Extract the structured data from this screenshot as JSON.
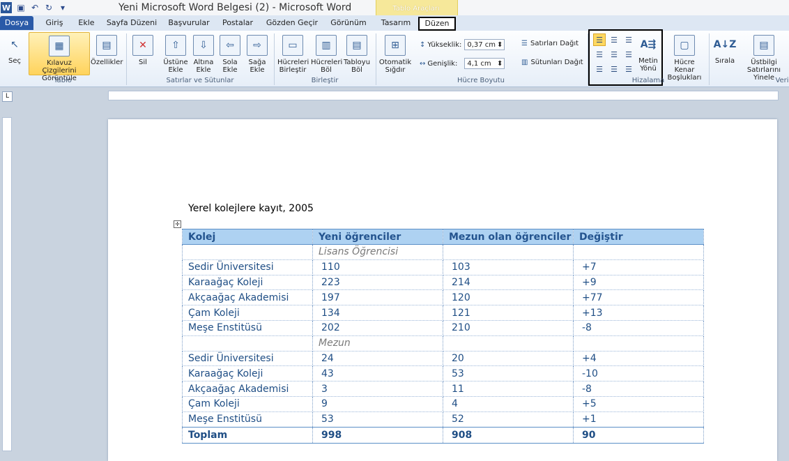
{
  "window": {
    "title": "Yeni Microsoft Word Belgesi (2) - Microsoft Word",
    "context_tab_group": "Tablo Araçları"
  },
  "tabs": [
    {
      "label": "Dosya"
    },
    {
      "label": "Giriş"
    },
    {
      "label": "Ekle"
    },
    {
      "label": "Sayfa Düzeni"
    },
    {
      "label": "Başvurular"
    },
    {
      "label": "Postalar"
    },
    {
      "label": "Gözden Geçir"
    },
    {
      "label": "Görünüm"
    },
    {
      "label": "Tasarım"
    },
    {
      "label": "Düzen"
    }
  ],
  "ribbon": {
    "tablo": {
      "label": "Tablo",
      "sec": "Seç",
      "kilavuz": "Kılavuz Çizgilerini Görüntüle",
      "ozellikler": "Özellikler"
    },
    "satirlar": {
      "label": "Satırlar ve Sütunlar",
      "sil": "Sil",
      "ustune": "Üstüne Ekle",
      "altina": "Altına Ekle",
      "sola": "Sola Ekle",
      "saga": "Sağa Ekle"
    },
    "birlestir": {
      "label": "Birleştir",
      "hucre_birlestir": "Hücreleri Birleştir",
      "hucre_bol": "Hücreleri Böl",
      "tablo_bol": "Tabloyu Böl"
    },
    "boyut": {
      "label": "Hücre Boyutu",
      "otomatik": "Otomatik Sığdır",
      "yukseklik_label": "Yükseklik:",
      "yukseklik": "0,37 cm",
      "genislik_label": "Genişlik:",
      "genislik": "4,1 cm",
      "satir_dagit": "Satırları Dağıt",
      "sutun_dagit": "Sütunları Dağıt"
    },
    "hizalama": {
      "label": "Hizalama",
      "metin_yonu": "Metin Yönü",
      "kenar": "Hücre Kenar Boşlukları"
    },
    "veri": {
      "label": "Veri",
      "sirala": "Sırala",
      "ustbilgi": "Üstbilgi Satırlarını Yinele"
    }
  },
  "document": {
    "title": "Yerel kolejlere kayıt, 2005",
    "columns": [
      "Kolej",
      "Yeni öğrenciler",
      "Mezun olan öğrenciler",
      "Değiştir"
    ],
    "rows": [
      {
        "type": "sub",
        "cells": [
          "",
          "Lisans Öğrencisi",
          "",
          ""
        ]
      },
      {
        "type": "row",
        "cells": [
          "Sedir Üniversitesi",
          "110",
          "103",
          "+7"
        ]
      },
      {
        "type": "row",
        "cells": [
          "Karaağaç Koleji",
          "223",
          "214",
          "+9"
        ]
      },
      {
        "type": "row",
        "cells": [
          "Akçaağaç Akademisi",
          "197",
          "120",
          "+77"
        ]
      },
      {
        "type": "row",
        "cells": [
          "Çam Koleji",
          "134",
          "121",
          "+13"
        ]
      },
      {
        "type": "row",
        "cells": [
          "Meşe Enstitüsü",
          "202",
          "210",
          "-8"
        ]
      },
      {
        "type": "sub",
        "cells": [
          "",
          "Mezun",
          "",
          ""
        ]
      },
      {
        "type": "row",
        "cells": [
          "Sedir Üniversitesi",
          "24",
          "20",
          "+4"
        ]
      },
      {
        "type": "row",
        "cells": [
          "Karaağaç Koleji",
          "43",
          "53",
          "-10"
        ]
      },
      {
        "type": "row",
        "cells": [
          "Akçaağaç Akademisi",
          "3",
          "11",
          "-8"
        ]
      },
      {
        "type": "row",
        "cells": [
          "Çam Koleji",
          "9",
          "4",
          "+5"
        ]
      },
      {
        "type": "row",
        "cells": [
          "Meşe Enstitüsü",
          "53",
          "52",
          "+1"
        ]
      },
      {
        "type": "total",
        "cells": [
          "Toplam",
          "998",
          "908",
          "90"
        ]
      }
    ]
  }
}
